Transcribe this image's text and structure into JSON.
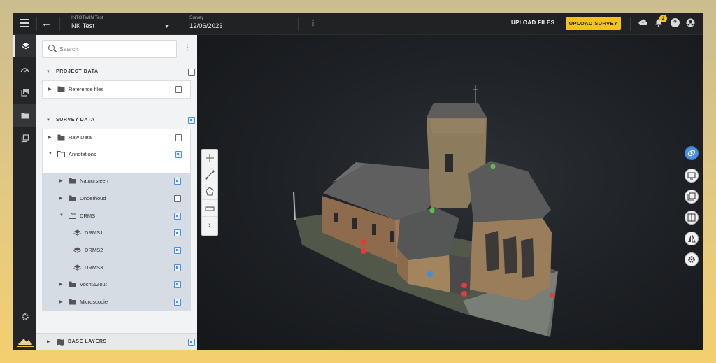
{
  "topbar": {
    "org_label": "INTOTWIN Test",
    "project_name": "NK Test",
    "survey_label": "Survey",
    "survey_date": "12/06/2023",
    "upload_files": "UPLOAD FILES",
    "upload_survey": "UPLOAD SURVEY",
    "notification_count": "2",
    "icons": [
      "menu-icon",
      "back-arrow-icon",
      "chevron-down-icon",
      "more-vert-icon",
      "cloud-upload-icon",
      "bell-icon",
      "help-icon",
      "account-icon"
    ]
  },
  "rail": {
    "items": [
      "layers-icon",
      "speedometer-icon",
      "gallery-icon",
      "folder-icon",
      "copy-icon"
    ],
    "bottom": [
      "gear-icon",
      "logo"
    ]
  },
  "panel": {
    "search_placeholder": "Search",
    "sections": {
      "project_data": "PROJECT DATA",
      "survey_data": "SURVEY DATA",
      "base_layers": "BASE LAYERS"
    },
    "items": {
      "reference_files": "Reference files",
      "raw_data": "Raw Data",
      "annotations": "Annotations",
      "natuursteen": "Natuursteen",
      "onderhoud": "Onderhoud",
      "drms": "DRMS",
      "drms1": "DRMS1",
      "drms2": "DRMS2",
      "drms3": "DRMS3",
      "vocht_zout": "Vocht&Zout",
      "microscopie": "Microscopie"
    }
  },
  "colors": {
    "accent": "#f4c317",
    "checkbox_on": "#4a8fe8",
    "annotation_red": "#e33b3b",
    "annotation_blue": "#3d8fe0",
    "annotation_green": "#5bbf4a"
  },
  "viewport": {
    "tools": [
      "crosshair-icon",
      "measure-line-icon",
      "polygon-icon",
      "ruler-icon",
      "chevron-right-icon"
    ],
    "right_tools": [
      "orbit-icon",
      "screen-icon",
      "layers-copy-icon",
      "compare-icon",
      "flip-icon",
      "settings-icon"
    ]
  }
}
